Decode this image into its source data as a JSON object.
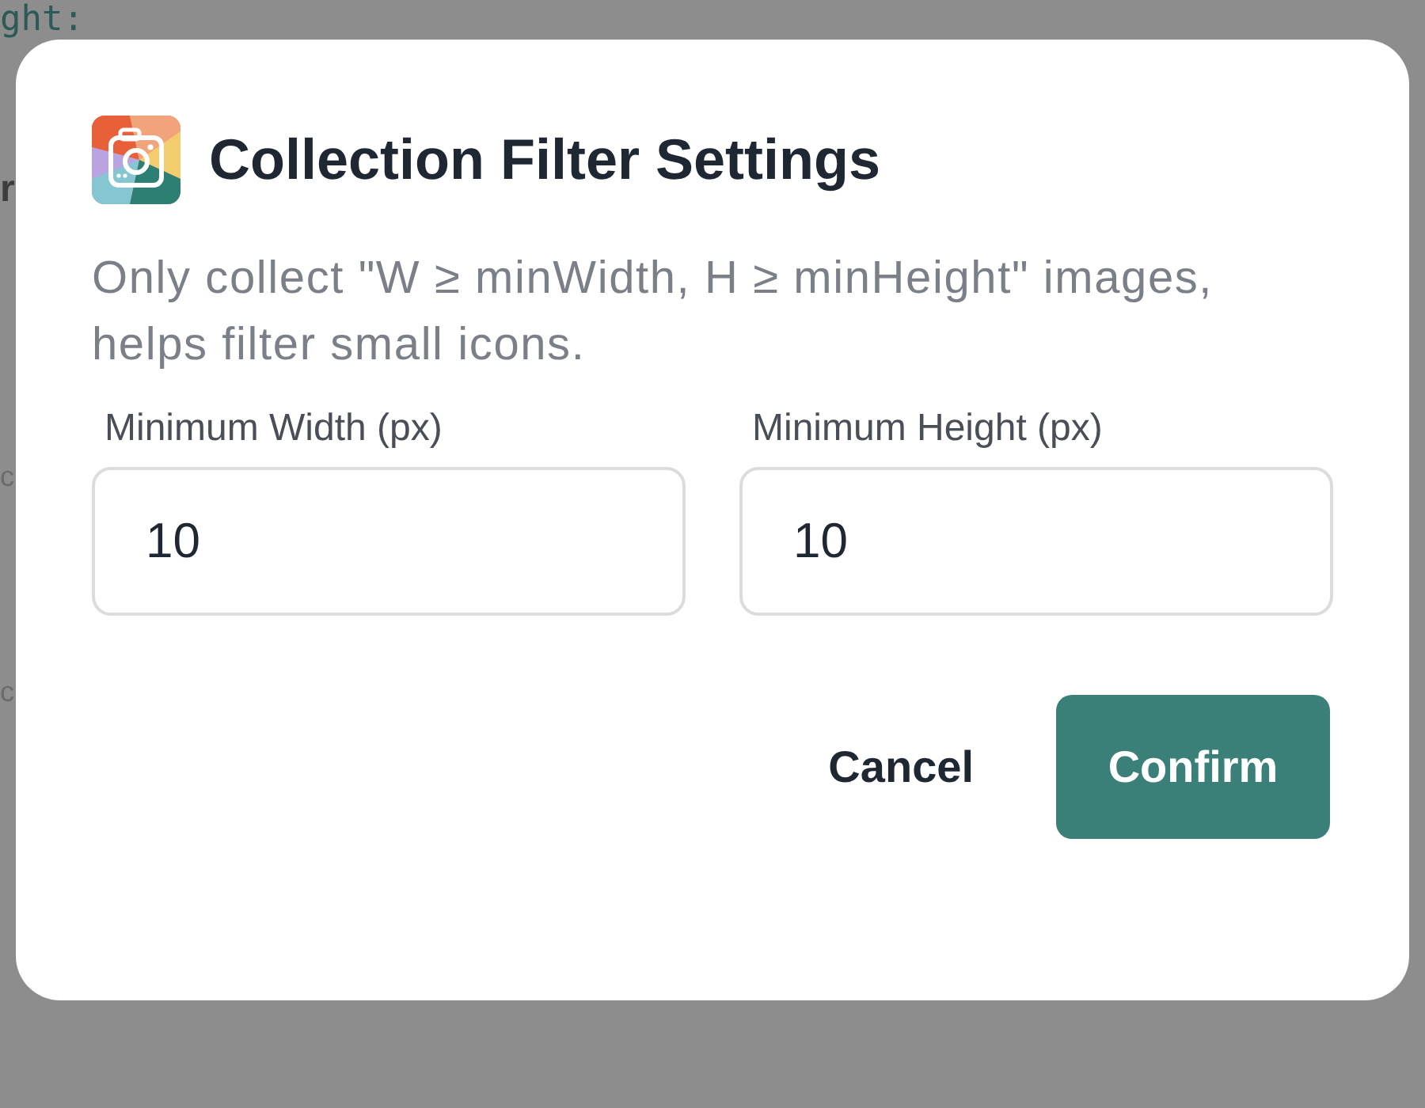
{
  "background_fragments": [
    {
      "text": "ght:",
      "kind": "code"
    },
    {
      "text": "r",
      "kind": "heading"
    },
    {
      "text": "c",
      "kind": "sub"
    },
    {
      "text": "c",
      "kind": "sub"
    }
  ],
  "dialog": {
    "title": "Collection Filter Settings",
    "description": "Only collect \"W ≥ minWidth, H ≥ minHeight\" images, helps filter small icons.",
    "fields": [
      {
        "label": "Minimum Width (px)",
        "value": "10"
      },
      {
        "label": "Minimum Height (px)",
        "value": "10"
      }
    ],
    "buttons": [
      {
        "label": "Cancel",
        "kind": "text"
      },
      {
        "label": "Confirm",
        "kind": "primary"
      }
    ]
  }
}
